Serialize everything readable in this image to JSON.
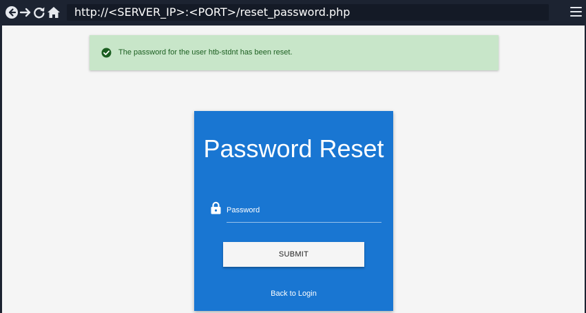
{
  "browser": {
    "url": "http://<SERVER_IP>:<PORT>/reset_password.php",
    "icons": {
      "back": "back-arrow-icon",
      "forward": "forward-arrow-icon",
      "reload": "reload-icon",
      "home": "home-icon",
      "menu": "hamburger-menu-icon"
    }
  },
  "alert": {
    "icon": "check-circle-icon",
    "message": "The password for the user htb-stdnt has been reset.",
    "colors": {
      "background": "#c8e6c9",
      "text": "#1b5e20",
      "icon": "#1b5e20"
    }
  },
  "form": {
    "title": "Password Reset",
    "field_icon": "lock-icon",
    "password_placeholder": "Password",
    "password_value": "",
    "submit_label": "SUBMIT",
    "back_link": "Back to Login",
    "colors": {
      "card": "#1976d2",
      "button": "#f5f5f5"
    }
  }
}
